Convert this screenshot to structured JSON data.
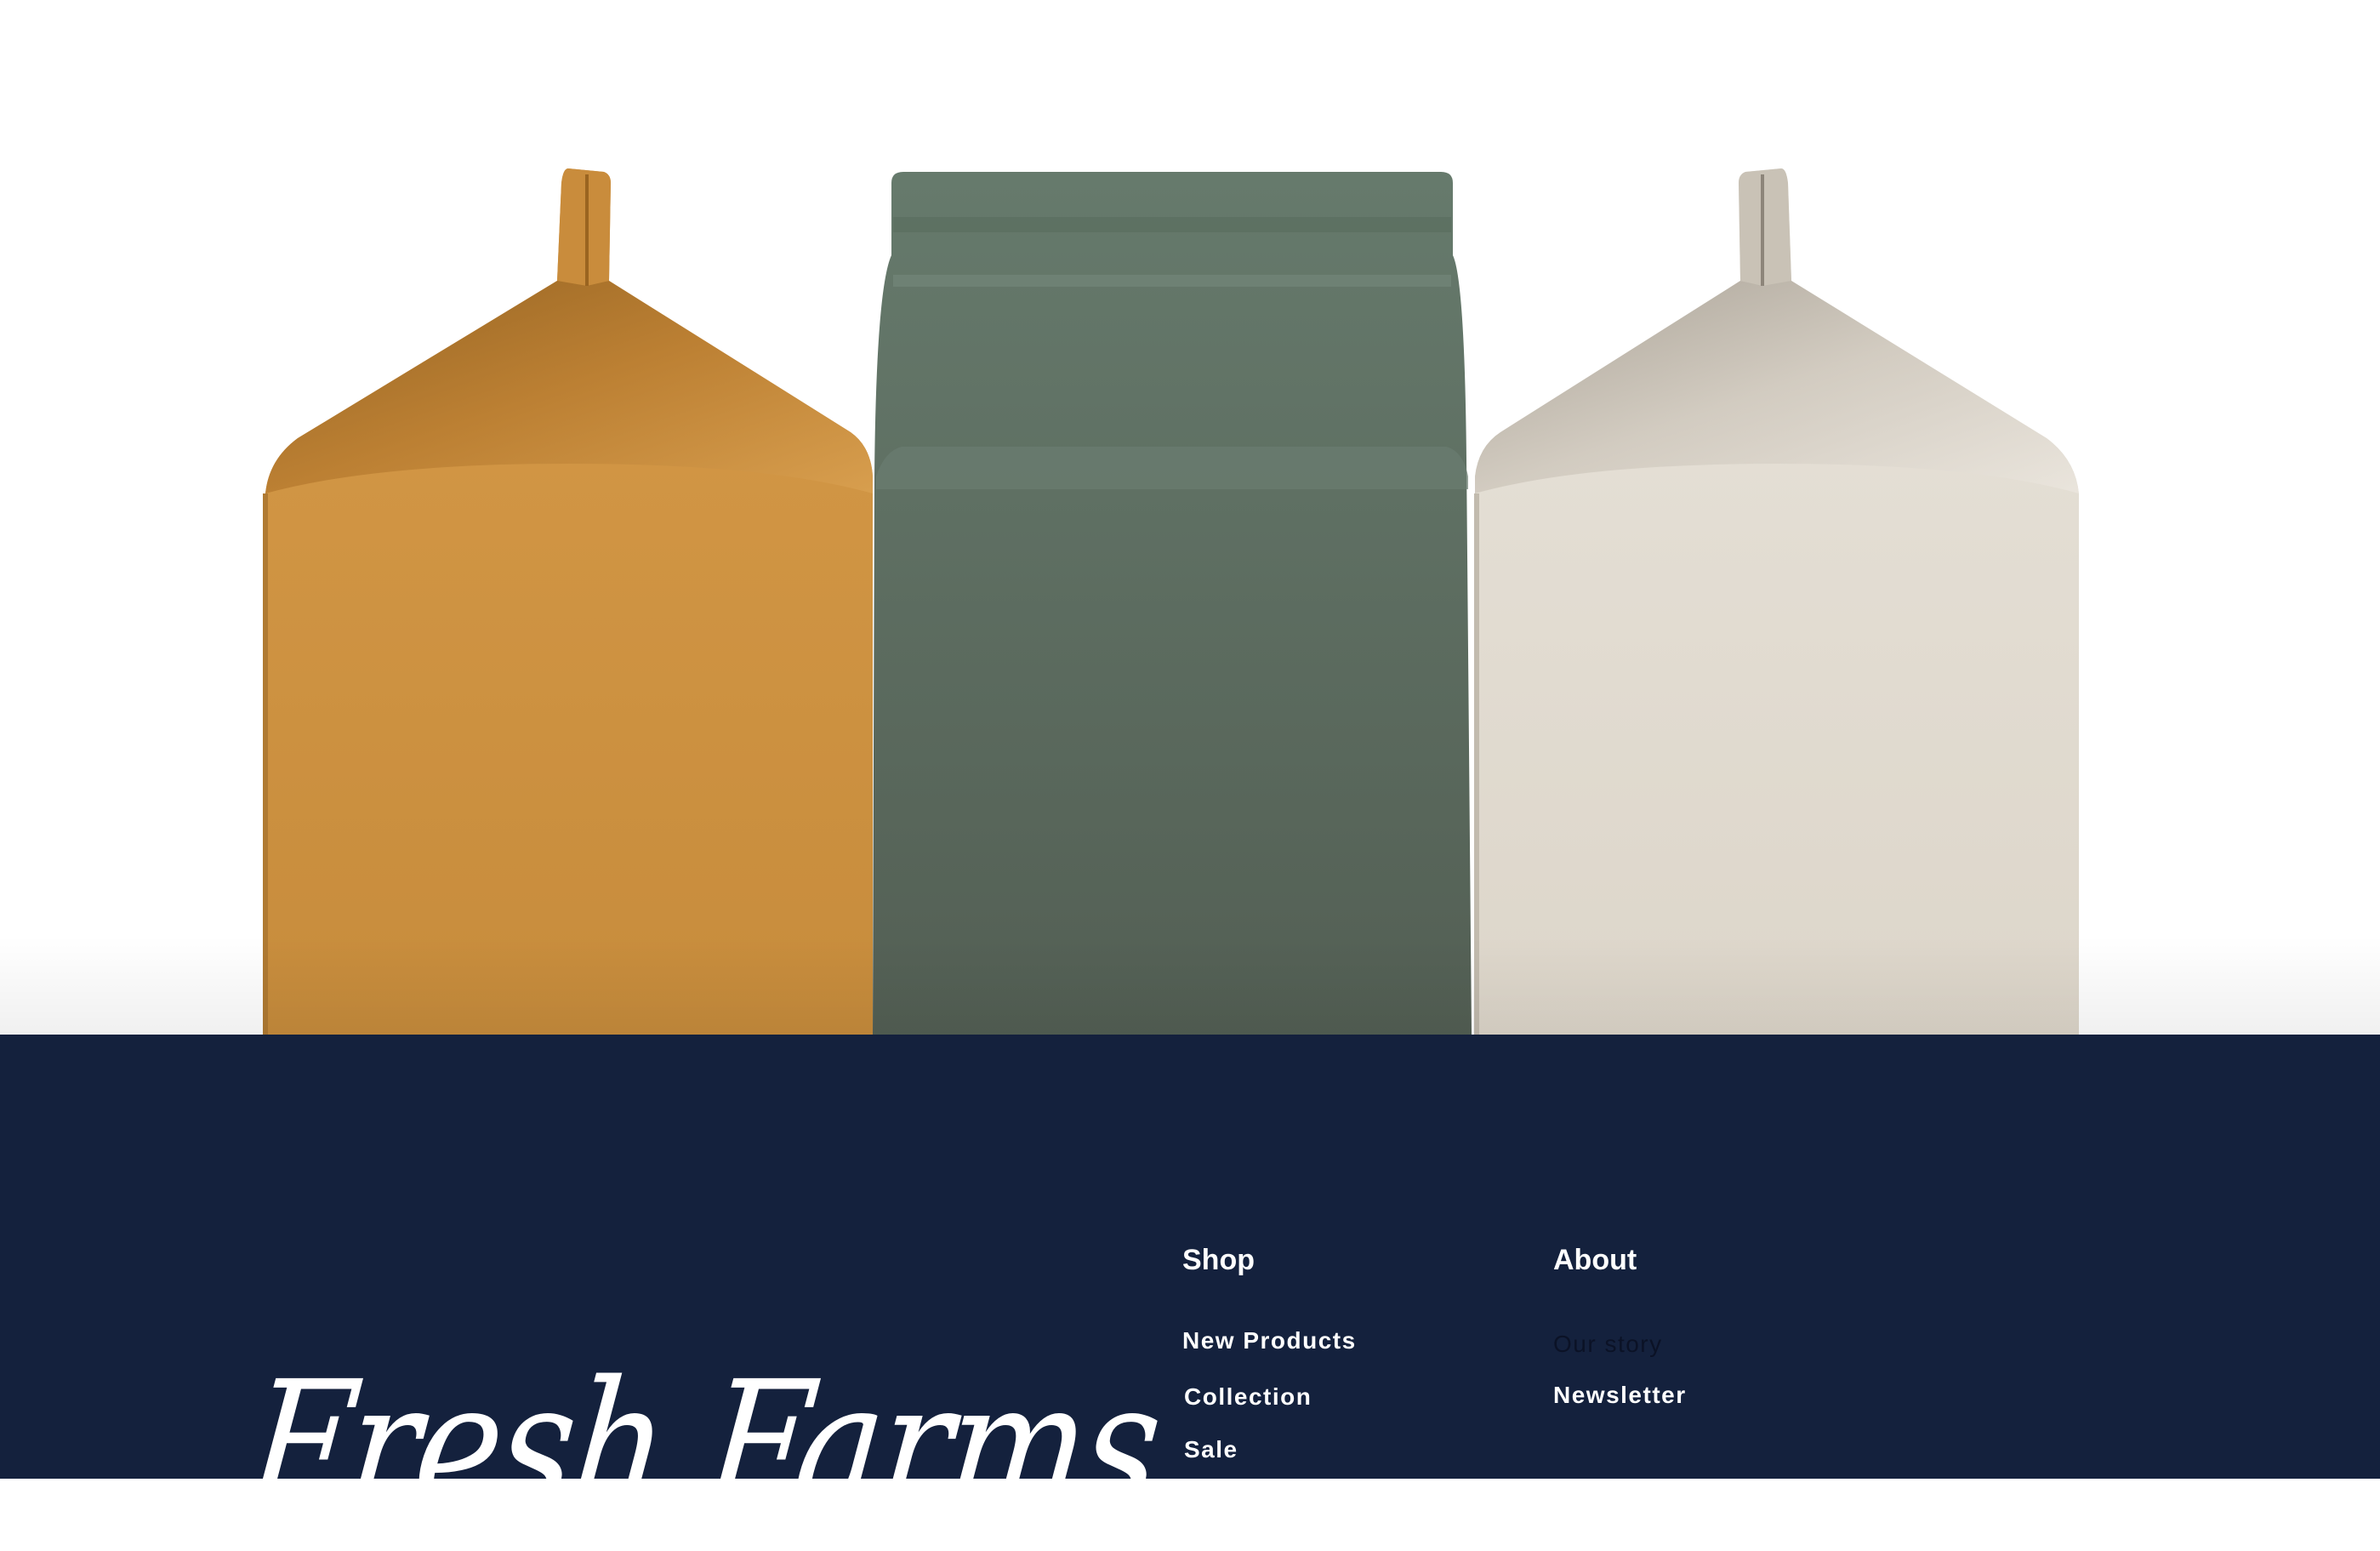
{
  "colors": {
    "footer_bg": "#14213d",
    "carton_orange": "#cb9140",
    "carton_green": "#596a5e",
    "carton_cream": "#dfd8cc"
  },
  "hero": {
    "image_description_icon": "milk-carton-trio-image"
  },
  "footer": {
    "brand": "Fresh Farms",
    "shop": {
      "title": "Shop",
      "links": [
        "New Products",
        "Collection",
        "Sale"
      ]
    },
    "about": {
      "title": "About",
      "links": [
        "Our story",
        "Newsletter"
      ]
    }
  }
}
